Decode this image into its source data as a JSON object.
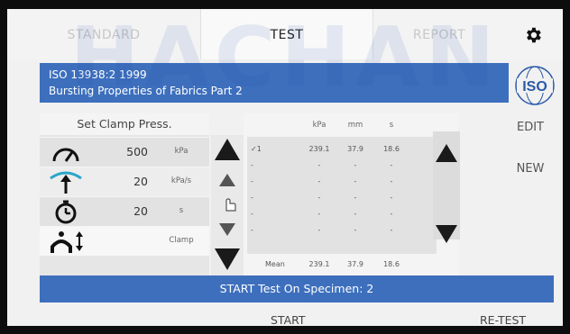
{
  "watermark": "HACHAN",
  "tabs": [
    {
      "label": "STANDARD",
      "active": false
    },
    {
      "label": "TEST",
      "active": true
    },
    {
      "label": "REPORT",
      "active": false
    }
  ],
  "title": {
    "line1": "ISO 13938:2 1999",
    "line2": "Bursting Properties of Fabrics Part 2"
  },
  "iso_logo_text": "ISO",
  "clamp_header": "Set Clamp Press.",
  "params": [
    {
      "icon": "gauge-icon",
      "value": "500",
      "unit": "kPa"
    },
    {
      "icon": "pressure-rate-icon",
      "value": "20",
      "unit": "kPa/s"
    },
    {
      "icon": "timer-icon",
      "value": "20",
      "unit": "s"
    },
    {
      "icon": "clamp-icon",
      "value": "",
      "unit": "Clamp"
    }
  ],
  "results": {
    "headers": [
      "kPa",
      "mm",
      "s"
    ],
    "rows": [
      {
        "label": "✓1",
        "values": [
          "239.1",
          "37.9",
          "18.6"
        ]
      },
      {
        "label": "-",
        "values": [
          "-",
          "-",
          "-"
        ]
      },
      {
        "label": "-",
        "values": [
          "-",
          "-",
          "-"
        ]
      },
      {
        "label": "-",
        "values": [
          "-",
          "-",
          "-"
        ]
      },
      {
        "label": "-",
        "values": [
          "-",
          "-",
          "-"
        ]
      },
      {
        "label": "-",
        "values": [
          "-",
          "-",
          "-"
        ]
      }
    ],
    "mean": {
      "label": "Mean",
      "values": [
        "239.1",
        "37.9",
        "18.6"
      ]
    }
  },
  "side_buttons": {
    "edit": "EDIT",
    "new": "NEW"
  },
  "status": "START Test On Specimen: 2",
  "bottom": {
    "start": "START",
    "retest": "RE-TEST"
  },
  "colors": {
    "accent": "#3d6fbd",
    "panel": "#e6e6e6",
    "dark": "#1a1a1a"
  }
}
